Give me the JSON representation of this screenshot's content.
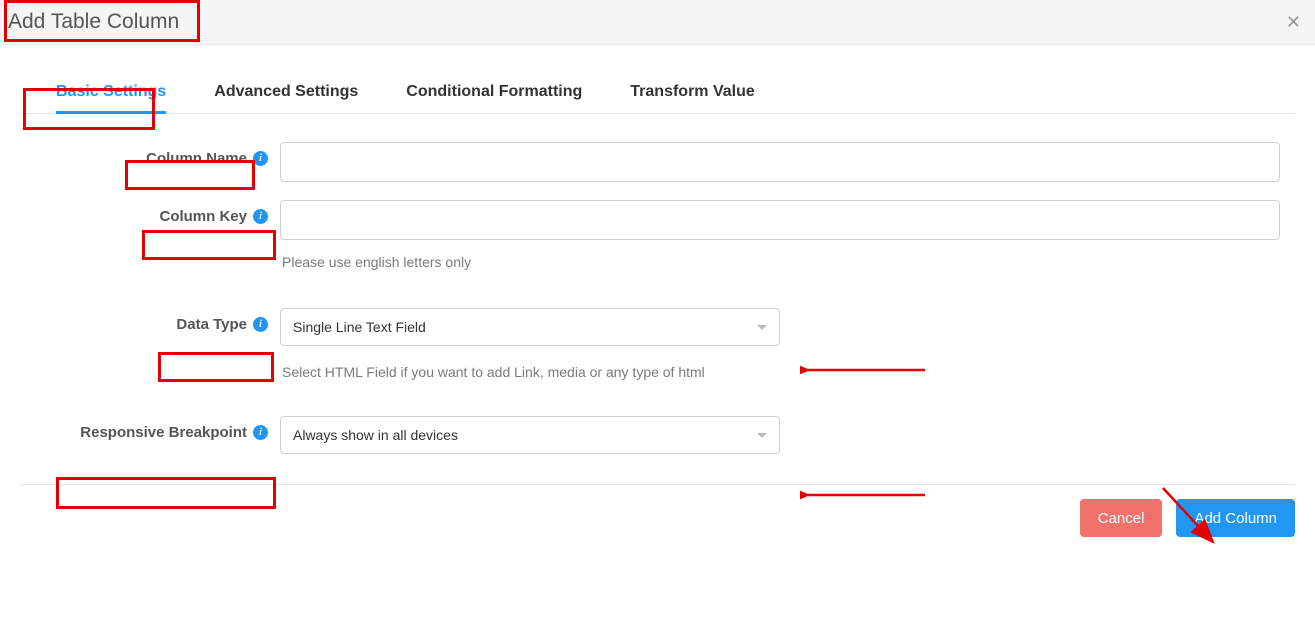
{
  "header": {
    "title": "Add Table Column"
  },
  "tabs": [
    {
      "label": "Basic Settings",
      "active": true
    },
    {
      "label": "Advanced Settings",
      "active": false
    },
    {
      "label": "Conditional Formatting",
      "active": false
    },
    {
      "label": "Transform Value",
      "active": false
    }
  ],
  "fields": {
    "columnName": {
      "label": "Column Name",
      "value": ""
    },
    "columnKey": {
      "label": "Column Key",
      "value": "",
      "help": "Please use english letters only"
    },
    "dataType": {
      "label": "Data Type",
      "selected": "Single Line Text Field",
      "help": "Select HTML Field if you want to add Link, media or any type of html"
    },
    "breakpoint": {
      "label": "Responsive Breakpoint",
      "selected": "Always show in all devices"
    }
  },
  "footer": {
    "cancel": "Cancel",
    "add": "Add Column"
  }
}
